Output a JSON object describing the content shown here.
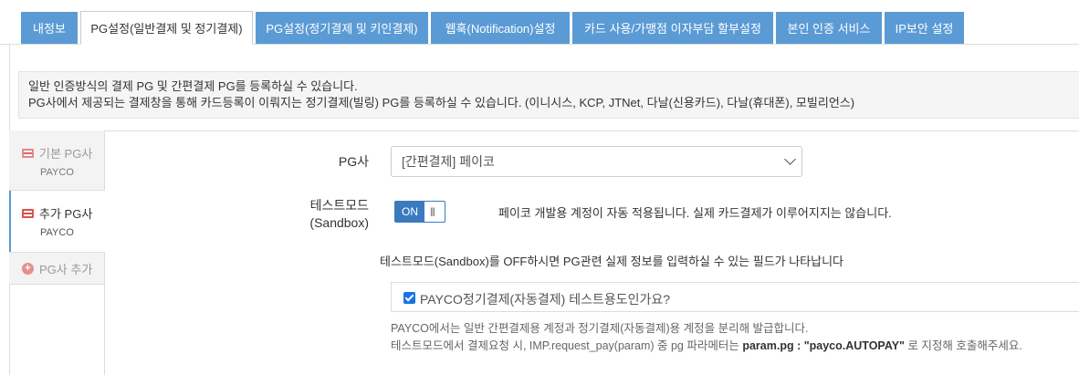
{
  "tabs": [
    {
      "label": "내정보"
    },
    {
      "label": "PG설정(일반결제 및 정기결제)"
    },
    {
      "label": "PG설정(정기결제 및 키인결제)"
    },
    {
      "label": "웹훅(Notification)설정"
    },
    {
      "label": "카드 사용/가맹점 이자부담 할부설정"
    },
    {
      "label": "본인 인증 서비스"
    },
    {
      "label": "IP보안 설정"
    }
  ],
  "notice": {
    "line1": "일반 인증방식의 결제 PG 및 간편결제 PG를 등록하실 수 있습니다.",
    "line2": "PG사에서 제공되는 결제창을 통해 카드등록이 이뤄지는 정기결제(빌링) PG를 등록하실 수 있습니다. (이니시스, KCP, JTNet, 다날(신용카드), 다날(휴대폰), 모빌리언스)"
  },
  "sidenav": {
    "basic_title": "기본 PG사",
    "basic_sub": "PAYCO",
    "extra_title": "추가 PG사",
    "extra_sub": "PAYCO",
    "add_label": "PG사 추가"
  },
  "form": {
    "pg_label": "PG사",
    "pg_selected": "[간편결제] 페이코",
    "test_label_1": "테스트모드",
    "test_label_2": "(Sandbox)",
    "toggle_on": "ON",
    "toggle_grip": "|||",
    "test_desc": "페이코 개발용 계정이 자동 적용됩니다. 실제 카드결제가 이루어지지는 않습니다.",
    "sandbox_note": "테스트모드(Sandbox)를 OFF하시면 PG관련 실제 정보를 입력하실 수 있는 필드가 나타납니다",
    "checkbox_label": "PAYCO정기결제(자동결제) 테스트용도인가요?",
    "checkbox_checked": true,
    "help1": "PAYCO에서는 일반 간편결제용 계정과 정기결제(자동결제)용 계정을 분리해 발급합니다.",
    "help2_prefix": "테스트모드에서 결제요청 시, IMP.request_pay(param) 중 pg 파라메터는 ",
    "help2_bold": "param.pg : \"payco.AUTOPAY\"",
    "help2_suffix": " 로 지정해 호출해주세요."
  },
  "colors": {
    "tab_bg": "#5b9bd5",
    "toggle_on": "#3a7bc0",
    "checkbox": "#1a73e8",
    "icon_red": "#d9534f"
  }
}
